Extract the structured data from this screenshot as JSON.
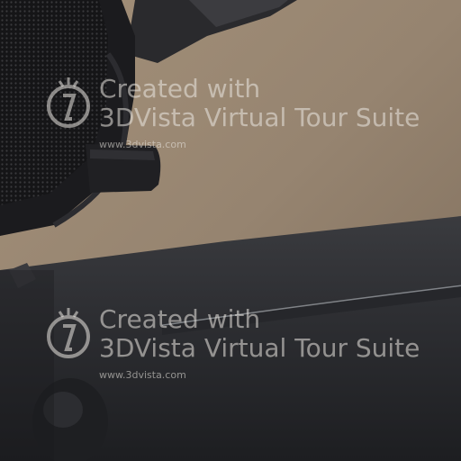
{
  "watermark": {
    "line1": "Created with",
    "line2": "3DVista Virtual Tour Suite",
    "url": "www.3dvista.com"
  },
  "colors": {
    "wall": "#9c8a74",
    "wall_dark": "#7d6d5a",
    "object_dark": "#1c1c1f",
    "surface_dark": "#2e2f33",
    "edge_highlight": "#8d9196"
  }
}
